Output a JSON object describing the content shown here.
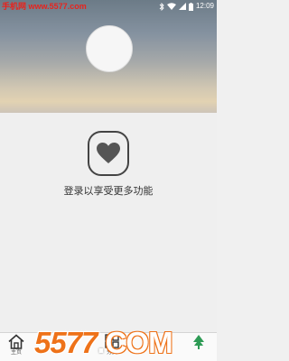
{
  "status_bar": {
    "watermark": "手机网 www.5577.com",
    "time": "12:09",
    "icons": [
      "bluetooth-icon",
      "wifi-icon",
      "signal-icon",
      "battery-icon"
    ]
  },
  "header": {
    "avatar_icon": "avatar-placeholder"
  },
  "login": {
    "icon": "heart-icon",
    "prompt": "登录以享受更多功能"
  },
  "tab_bar": {
    "tabs": [
      {
        "label": "主页",
        "icon": "home-icon"
      },
      {
        "label": "分类",
        "icon": "grid-icon"
      },
      {
        "label": "",
        "icon": "tree-icon"
      }
    ]
  },
  "watermark_bottom": {
    "number": "5577",
    "dot": ".",
    "domain": "COM"
  },
  "colors": {
    "watermark_red": "#e8231d",
    "watermark_orange": "#ee7219",
    "heart": "#555555",
    "tab_green": "#2e9b55"
  }
}
